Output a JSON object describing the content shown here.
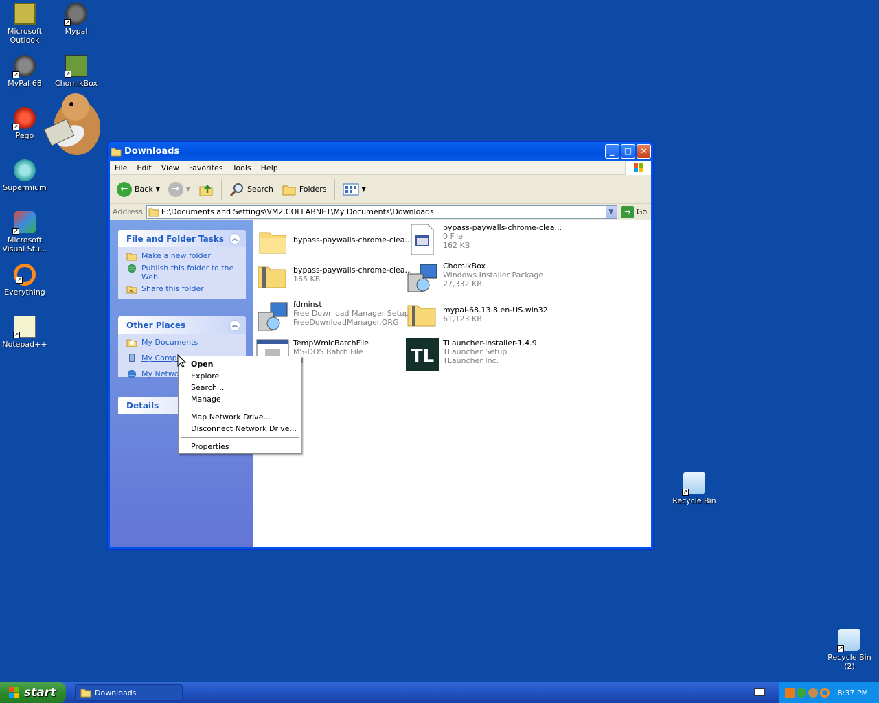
{
  "desktop": {
    "icons": [
      {
        "label": "Microsoft\nOutlook"
      },
      {
        "label": "Mypal"
      },
      {
        "label": "MyPal 68"
      },
      {
        "label": "ChomikBox"
      },
      {
        "label": "Pego"
      },
      {
        "label": "Supermium"
      },
      {
        "label": "Microsoft\nVisual Stu..."
      },
      {
        "label": "Everything"
      },
      {
        "label": "Notepad++"
      },
      {
        "label": "Recycle Bin"
      },
      {
        "label": "Recycle Bin (2)"
      }
    ]
  },
  "window": {
    "title": "Downloads",
    "menu": [
      "File",
      "Edit",
      "View",
      "Favorites",
      "Tools",
      "Help"
    ],
    "toolbar": {
      "back": "Back",
      "search": "Search",
      "folders": "Folders"
    },
    "address": {
      "label": "Address",
      "value": "E:\\Documents and Settings\\VM2.COLLABNET\\My Documents\\Downloads",
      "go": "Go"
    },
    "tasks": {
      "title": "File and Folder Tasks",
      "items": [
        "Make a new folder",
        "Publish this folder to the Web",
        "Share this folder"
      ]
    },
    "places": {
      "title": "Other Places",
      "items": [
        "My Documents",
        "My Compu",
        "My Networ"
      ]
    },
    "details": {
      "title": "Details"
    },
    "files": [
      {
        "name": "bypass-paywalls-chrome-clea...",
        "line2": "",
        "line3": ""
      },
      {
        "name": "bypass-paywalls-chrome-clea...",
        "line2": "0 File",
        "line3": "162 KB"
      },
      {
        "name": "bypass-paywalls-chrome-clea...",
        "line2": "165 KB",
        "line3": ""
      },
      {
        "name": "ChomikBox",
        "line2": "Windows Installer Package",
        "line3": "27,332 KB"
      },
      {
        "name": "fdminst",
        "line2": "Free Download Manager Setup",
        "line3": "FreeDownloadManager.ORG"
      },
      {
        "name": "mypal-68.13.8.en-US.win32",
        "line2": "61,123 KB",
        "line3": ""
      },
      {
        "name": "TempWmicBatchFile",
        "line2": "MS-DOS Batch File",
        "line3": "KB"
      },
      {
        "name": "TLauncher-Installer-1.4.9",
        "line2": "TLauncher Setup",
        "line3": "TLauncher Inc."
      }
    ]
  },
  "context_menu": {
    "items": [
      "Open",
      "Explore",
      "Search...",
      "Manage",
      "Map Network Drive...",
      "Disconnect Network Drive...",
      "Properties"
    ]
  },
  "taskbar": {
    "start": "start",
    "task": "Downloads",
    "clock": "8:37 PM"
  }
}
